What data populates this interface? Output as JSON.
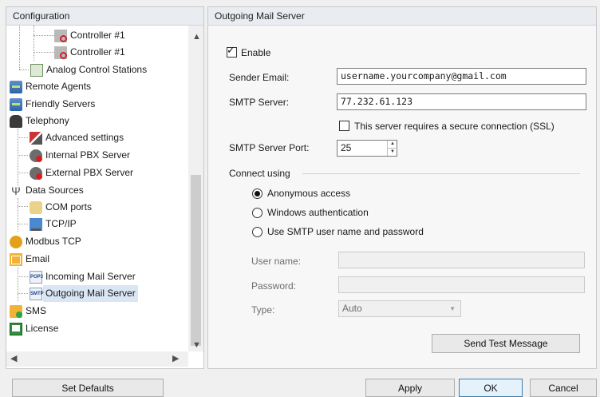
{
  "left_panel": {
    "header": "Configuration",
    "tree": [
      {
        "label": "Controller #1",
        "icon": "controller-xbc-icon",
        "indent": 3
      },
      {
        "label": "Controller #1",
        "icon": "controller-xbt-icon",
        "indent": 3
      },
      {
        "label": "Analog Control Stations",
        "icon": "analog-station-icon",
        "indent": 2
      },
      {
        "label": "Remote Agents",
        "icon": "server-icon",
        "indent": 0
      },
      {
        "label": "Friendly Servers",
        "icon": "server-icon",
        "indent": 0
      },
      {
        "label": "Telephony",
        "icon": "telephone-icon",
        "indent": 0
      },
      {
        "label": "Advanced settings",
        "icon": "tools-icon",
        "indent": 1
      },
      {
        "label": "Internal PBX Server",
        "icon": "pbx-icon",
        "indent": 1
      },
      {
        "label": "External PBX Server",
        "icon": "pbx-icon",
        "indent": 1
      },
      {
        "label": "Data Sources",
        "icon": "usb-icon",
        "indent": 0
      },
      {
        "label": "COM ports",
        "icon": "com-port-icon",
        "indent": 1
      },
      {
        "label": "TCP/IP",
        "icon": "network-icon",
        "indent": 1
      },
      {
        "label": "Modbus TCP",
        "icon": "gear-icon",
        "indent": 0
      },
      {
        "label": "Email",
        "icon": "email-icon",
        "indent": 0
      },
      {
        "label": "Incoming Mail Server",
        "icon": "pop3-icon",
        "indent": 1,
        "badge": "POP3"
      },
      {
        "label": "Outgoing Mail Server",
        "icon": "smtp-icon",
        "indent": 1,
        "badge": "SMTP",
        "selected": true
      },
      {
        "label": "SMS",
        "icon": "sms-icon",
        "indent": 0
      },
      {
        "label": "License",
        "icon": "license-icon",
        "indent": 0
      }
    ],
    "set_defaults_label": "Set Defaults"
  },
  "right_panel": {
    "header": "Outgoing Mail Server",
    "enable_label": "Enable",
    "enable_checked": true,
    "sender_email_label": "Sender Email:",
    "sender_email_value": "username.yourcompany@gmail.com",
    "smtp_server_label": "SMTP Server:",
    "smtp_server_value": "77.232.61.123",
    "ssl_label": "This server requires a secure connection (SSL)",
    "ssl_checked": false,
    "smtp_port_label": "SMTP Server Port:",
    "smtp_port_value": "25",
    "connect_using_label": "Connect using",
    "auth_options": [
      {
        "label": "Anonymous access",
        "selected": true
      },
      {
        "label": "Windows authentication",
        "selected": false
      },
      {
        "label": "Use SMTP user name and password",
        "selected": false
      }
    ],
    "user_name_label": "User name:",
    "password_label": "Password:",
    "type_label": "Type:",
    "type_value": "Auto",
    "send_test_label": "Send Test Message"
  },
  "footer": {
    "apply_label": "Apply",
    "ok_label": "OK",
    "cancel_label": "Cancel"
  }
}
